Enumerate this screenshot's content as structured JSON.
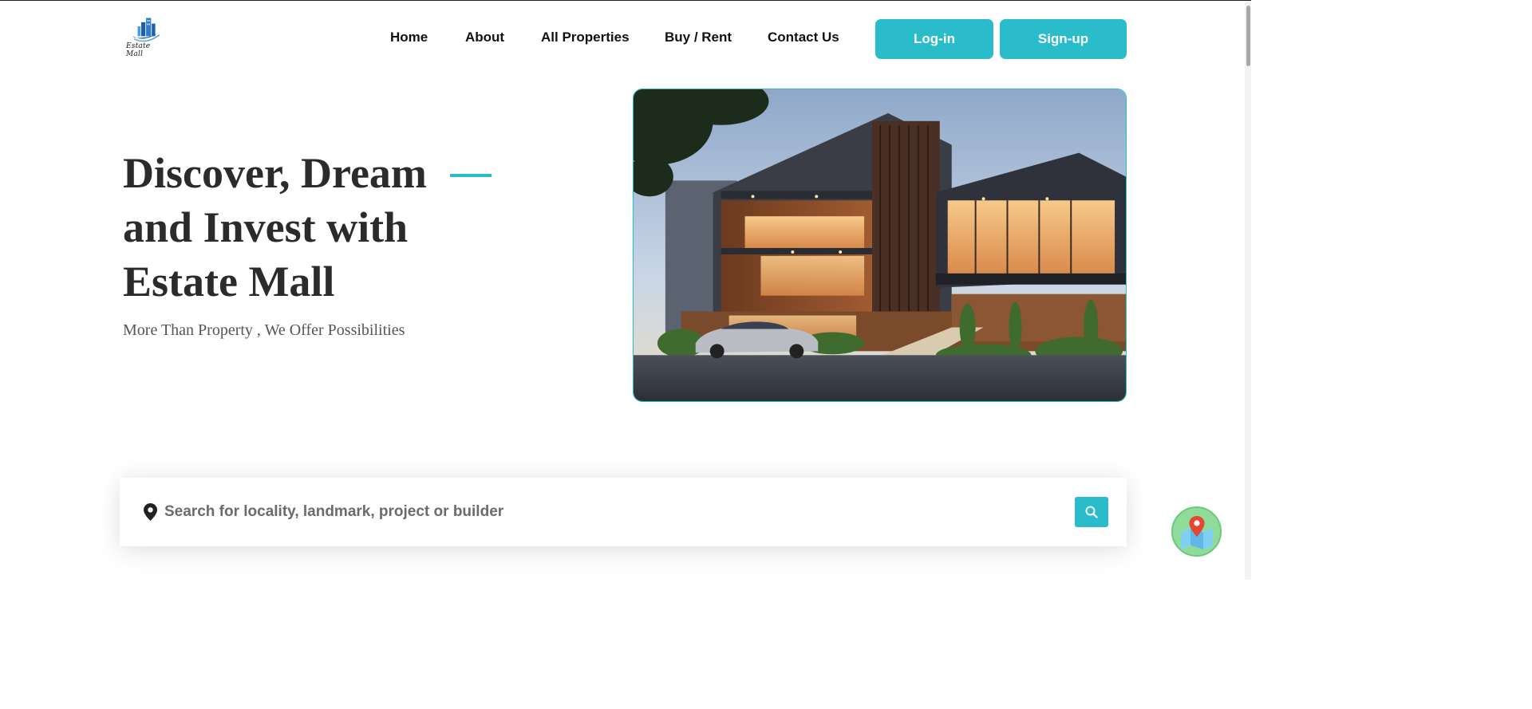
{
  "header": {
    "logo_text": "Estate Mall",
    "nav": {
      "home": "Home",
      "about": "About",
      "all_properties": "All Properties",
      "buy_rent": "Buy / Rent",
      "contact_us": "Contact Us"
    },
    "login_label": "Log-in",
    "signup_label": "Sign-up"
  },
  "hero": {
    "title_line1": "Discover, Dream",
    "title_line2": "and Invest with",
    "title_line3": "Estate Mall",
    "subtitle": "More Than Property , We Offer Possibilities",
    "image_icon": "modern-house-photo"
  },
  "search": {
    "placeholder": "Search for locality, landmark, project or builder",
    "value": "",
    "location_icon": "location-pin-icon",
    "button_icon": "search-icon"
  },
  "floating": {
    "map_icon": "map-icon"
  },
  "colors": {
    "accent": "#2bbccb",
    "heading": "#2b2b2b",
    "map_fab": "#8fdc9a"
  }
}
